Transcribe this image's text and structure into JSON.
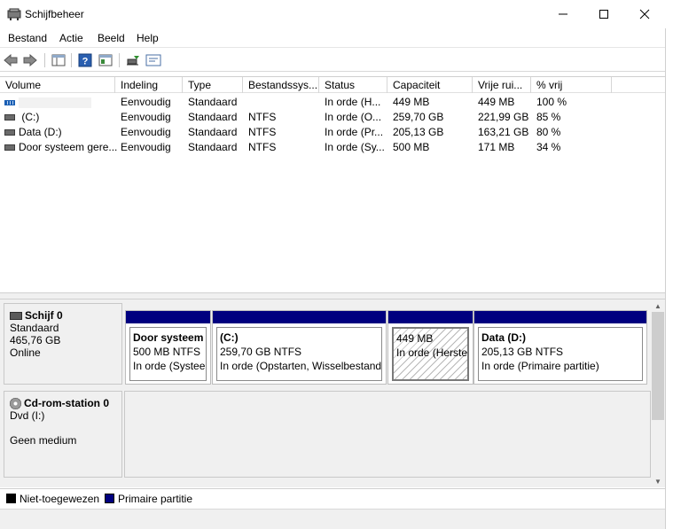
{
  "window": {
    "title": "Schijfbeheer",
    "minimize": "—",
    "maximize": "☐",
    "close": "✕"
  },
  "menu": [
    "Bestand",
    "Actie",
    "Beeld",
    "Help"
  ],
  "list": {
    "columns": [
      "Volume",
      "Indeling",
      "Type",
      "Bestandssys...",
      "Status",
      "Capaciteit",
      "Vrije rui...",
      "% vrij"
    ],
    "rows": [
      {
        "volume": "",
        "indeling": "Eenvoudig",
        "type": "Standaard",
        "fs": "",
        "status": "In orde (H...",
        "capacity": "449 MB",
        "free": "449 MB",
        "pct": "100 %"
      },
      {
        "volume": "(C:)",
        "indeling": "Eenvoudig",
        "type": "Standaard",
        "fs": "NTFS",
        "status": "In orde (O...",
        "capacity": "259,70 GB",
        "free": "221,99 GB",
        "pct": "85 %"
      },
      {
        "volume": "Data (D:)",
        "indeling": "Eenvoudig",
        "type": "Standaard",
        "fs": "NTFS",
        "status": "In orde (Pr...",
        "capacity": "205,13 GB",
        "free": "163,21 GB",
        "pct": "80 %"
      },
      {
        "volume": "Door systeem gere...",
        "indeling": "Eenvoudig",
        "type": "Standaard",
        "fs": "NTFS",
        "status": "In orde (Sy...",
        "capacity": "500 MB",
        "free": "171 MB",
        "pct": "34 %"
      }
    ]
  },
  "disk0": {
    "name": "Schijf 0",
    "type": "Standaard",
    "size": "465,76 GB",
    "state": "Online",
    "partitions": [
      {
        "title": "Door systeem g",
        "size": "500 MB NTFS",
        "status": "In orde (Systeer"
      },
      {
        "title": "(C:)",
        "size": "259,70 GB NTFS",
        "status": "In orde (Opstarten, Wisselbestand,"
      },
      {
        "title": "",
        "size": "449 MB",
        "status": "In orde (Herstel"
      },
      {
        "title": "Data  (D:)",
        "size": "205,13 GB NTFS",
        "status": "In orde (Primaire partitie)"
      }
    ]
  },
  "cdrom": {
    "name": "Cd-rom-station 0",
    "drive": "Dvd (I:)",
    "media": "Geen medium"
  },
  "legend": [
    {
      "label": "Niet-toegewezen",
      "color": "#000000"
    },
    {
      "label": "Primaire partitie",
      "color": "#00007f"
    }
  ],
  "toolbar_icons": [
    "back-icon",
    "forward-icon",
    "console-tree-icon",
    "help-icon",
    "properties-icon",
    "connect-icon",
    "settings-icon"
  ]
}
